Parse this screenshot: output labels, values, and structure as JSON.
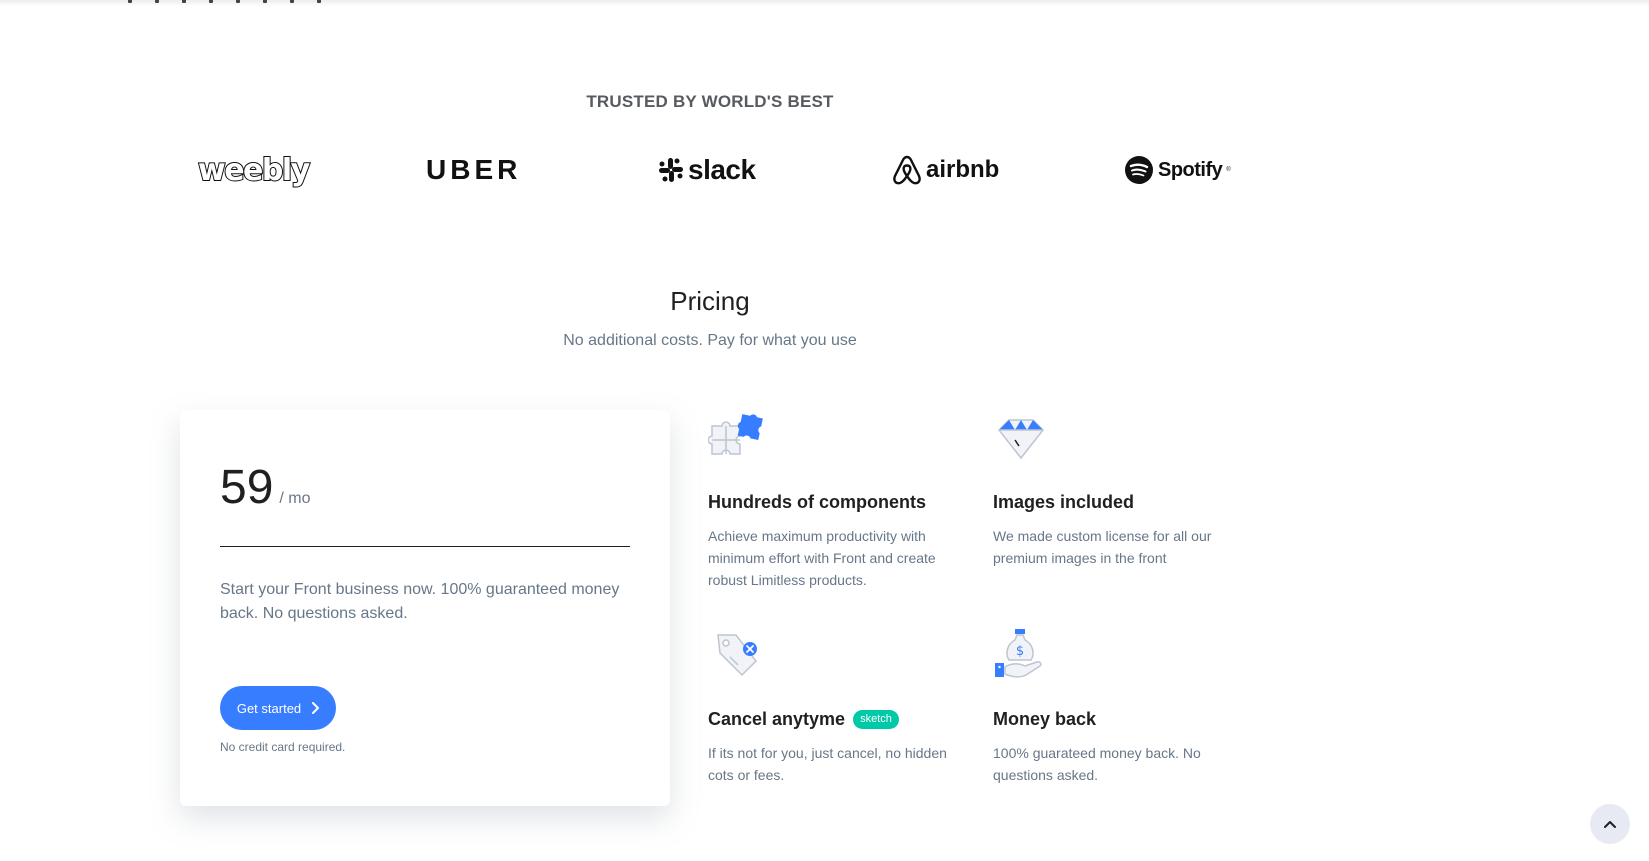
{
  "trusted": {
    "heading": "TRUSTED BY WORLD'S BEST"
  },
  "logos": {
    "weebly": "weebly",
    "uber": "UBER",
    "slack": "slack",
    "airbnb": "airbnb",
    "spotify": "Spotify",
    "spotify_mark": "®"
  },
  "pricing": {
    "title": "Pricing",
    "subtitle": "No additional costs. Pay for what you use"
  },
  "card": {
    "price": "59",
    "unit": "/ mo",
    "description": "Start your Front business now. 100% guaranteed money back. No questions asked.",
    "button_label": "Get started",
    "note": "No credit card required."
  },
  "features": [
    {
      "icon": "puzzle-icon",
      "title": "Hundreds of components",
      "text": "Achieve maximum productivity with minimum effort with Front and create robust Limitless products."
    },
    {
      "icon": "diamond-icon",
      "title": "Images included",
      "text": "We made custom license for all our premium images in the front"
    },
    {
      "icon": "price-tag-icon",
      "title": "Cancel anytyme",
      "badge": "sketch",
      "text": "If its not for you, just cancel, no hidden cots or fees."
    },
    {
      "icon": "money-bag-icon",
      "title": "Money back",
      "text": "100% guarateed money back. No questions asked."
    }
  ],
  "colors": {
    "primary": "#377dff",
    "badge": "#00c9a7",
    "muted": "#677788",
    "heading": "#1e2022"
  }
}
